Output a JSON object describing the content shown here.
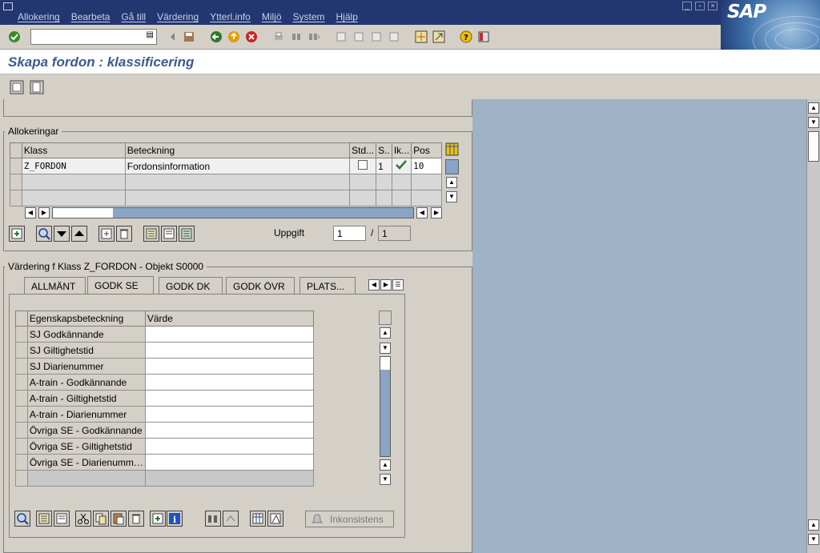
{
  "menubar": {
    "items": [
      "Allokering",
      "Bearbeta",
      "Gå till",
      "Värdering",
      "Ytterl.info",
      "Miljö",
      "System",
      "Hjälp"
    ],
    "logo": "SAP"
  },
  "title": "Skapa fordon : klassificering",
  "allocations": {
    "group_label": "Allokeringar",
    "columns": [
      "Klass",
      "Beteckning",
      "Std...",
      "S..",
      "Ik...",
      "Pos"
    ],
    "rows": [
      {
        "klass": "Z_FORDON",
        "beteckning": "Fordonsinformation",
        "std": false,
        "s": "1",
        "ik": "check-icon",
        "pos": "10"
      }
    ],
    "task_label": "Uppgift",
    "task_current": "1",
    "task_separator": "/",
    "task_total": "1"
  },
  "valuation": {
    "group_label": "Värdering f Klass Z_FORDON - Objekt S0000",
    "tabs": [
      "ALLMÄNT",
      "GODK SE",
      "GODK DK",
      "GODK ÖVR",
      "PLATS..."
    ],
    "active_tab": "GODK SE",
    "columns": [
      "Egenskapsbeteckning",
      "Värde"
    ],
    "rows": [
      "SJ Godkännande",
      "SJ Giltighetstid",
      "SJ Diarienummer",
      "A-train - Godkännande",
      "A-train - Giltighetstid",
      "A-train - Diarienummer",
      "Övriga SE - Godkännande",
      "Övriga SE - Giltighetstid",
      "Övriga SE - Diarienumm…"
    ],
    "inconsistency_button": "Inkonsistens"
  },
  "colors": {
    "menubar": "#22366f",
    "title": "#3d5a8d",
    "workarea": "#9fb2c6",
    "panel": "#d4d0c8"
  }
}
